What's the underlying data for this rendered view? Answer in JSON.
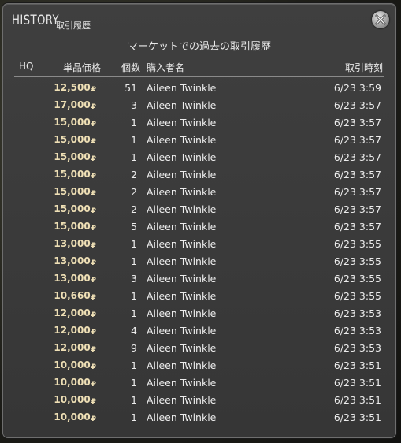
{
  "window": {
    "title_en": "HISTORY",
    "title_jp": "取引履歴",
    "subtitle": "マーケットでの過去の取引履歴"
  },
  "columns": {
    "hq": "HQ",
    "price": "単品価格",
    "qty": "個数",
    "buyer": "購入者名",
    "date": "取引時刻"
  },
  "currency_symbol": "₽",
  "rows": [
    {
      "price": "12,500",
      "qty": "51",
      "buyer": "Aileen Twinkle",
      "date": "6/23 3:59"
    },
    {
      "price": "17,000",
      "qty": "3",
      "buyer": "Aileen Twinkle",
      "date": "6/23 3:57"
    },
    {
      "price": "15,000",
      "qty": "1",
      "buyer": "Aileen Twinkle",
      "date": "6/23 3:57"
    },
    {
      "price": "15,000",
      "qty": "1",
      "buyer": "Aileen Twinkle",
      "date": "6/23 3:57"
    },
    {
      "price": "15,000",
      "qty": "1",
      "buyer": "Aileen Twinkle",
      "date": "6/23 3:57"
    },
    {
      "price": "15,000",
      "qty": "2",
      "buyer": "Aileen Twinkle",
      "date": "6/23 3:57"
    },
    {
      "price": "15,000",
      "qty": "2",
      "buyer": "Aileen Twinkle",
      "date": "6/23 3:57"
    },
    {
      "price": "15,000",
      "qty": "2",
      "buyer": "Aileen Twinkle",
      "date": "6/23 3:57"
    },
    {
      "price": "15,000",
      "qty": "5",
      "buyer": "Aileen Twinkle",
      "date": "6/23 3:57"
    },
    {
      "price": "13,000",
      "qty": "1",
      "buyer": "Aileen Twinkle",
      "date": "6/23 3:55"
    },
    {
      "price": "13,000",
      "qty": "1",
      "buyer": "Aileen Twinkle",
      "date": "6/23 3:55"
    },
    {
      "price": "13,000",
      "qty": "3",
      "buyer": "Aileen Twinkle",
      "date": "6/23 3:55"
    },
    {
      "price": "10,660",
      "qty": "1",
      "buyer": "Aileen Twinkle",
      "date": "6/23 3:55"
    },
    {
      "price": "12,000",
      "qty": "1",
      "buyer": "Aileen Twinkle",
      "date": "6/23 3:53"
    },
    {
      "price": "12,000",
      "qty": "4",
      "buyer": "Aileen Twinkle",
      "date": "6/23 3:53"
    },
    {
      "price": "12,000",
      "qty": "9",
      "buyer": "Aileen Twinkle",
      "date": "6/23 3:53"
    },
    {
      "price": "10,000",
      "qty": "1",
      "buyer": "Aileen Twinkle",
      "date": "6/23 3:51"
    },
    {
      "price": "10,000",
      "qty": "1",
      "buyer": "Aileen Twinkle",
      "date": "6/23 3:51"
    },
    {
      "price": "10,000",
      "qty": "1",
      "buyer": "Aileen Twinkle",
      "date": "6/23 3:51"
    },
    {
      "price": "10,000",
      "qty": "1",
      "buyer": "Aileen Twinkle",
      "date": "6/23 3:51"
    }
  ],
  "icons": {
    "close": "close-icon"
  }
}
